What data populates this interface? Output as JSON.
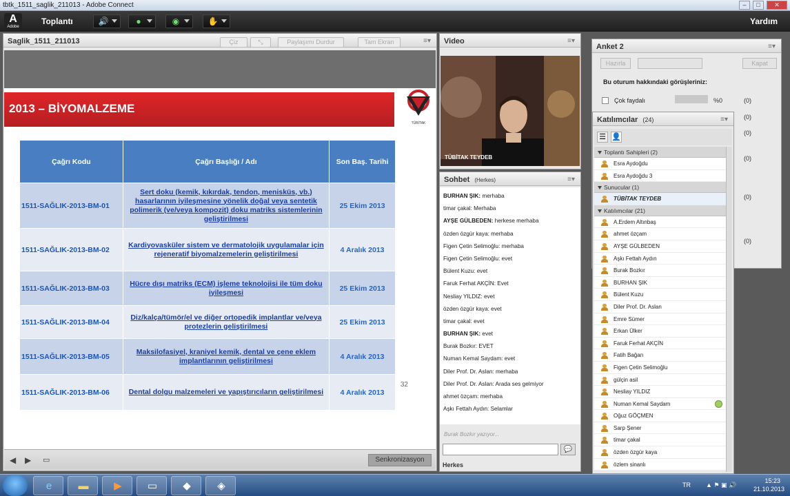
{
  "window": {
    "title": "tbtk_1511_saglik_211013 - Adobe Connect"
  },
  "menubar": {
    "logo_letter": "A",
    "logo_sub": "Adobe",
    "meeting_menu": "Toplantı",
    "help_menu": "Yardım"
  },
  "share_pod": {
    "title": "Saglik_1511_211013",
    "buttons": {
      "draw": "Çiz",
      "stop_sharing": "Paylaşımı Durdur",
      "fullscreen": "Tam Ekran"
    },
    "sync_button": "Senkronizasyon"
  },
  "slide": {
    "heading": "2013 – BİYOMALZEME",
    "logo_text": "TÜBİTAK",
    "page_number": "32",
    "table": {
      "headers": {
        "code": "Çağrı Kodu",
        "title": "Çağrı  Başlığı / Adı",
        "deadline": "Son Baş. Tarihi"
      },
      "rows": [
        {
          "code": "1511-SAĞLIK-2013-BM-01",
          "title": "Sert doku (kemik, kıkırdak, tendon, menisküs, vb.) hasarlarının iyileşmesine yönelik doğal veya sentetik polimerik (ve/veya kompozit) doku matriks sistemlerinin geliştirilmesi",
          "deadline": "25 Ekim 2013"
        },
        {
          "code": "1511-SAĞLIK-2013-BM-02",
          "title": "Kardiyovasküler sistem ve dermatolojik uygulamalar için rejeneratif biyomalzemelerin geliştirilmesi",
          "deadline": "4 Aralık 2013"
        },
        {
          "code": "1511-SAĞLIK-2013-BM-03",
          "title": "Hücre dışı matriks (ECM) işleme teknolojisi ile tüm doku iyileşmesi",
          "deadline": "25 Ekim 2013"
        },
        {
          "code": "1511-SAĞLIK-2013-BM-04",
          "title": "Diz/kalça/tümör/el ve diğer ortopedik implantlar ve/veya protezlerin geliştirilmesi",
          "deadline": "25 Ekim 2013"
        },
        {
          "code": "1511-SAĞLIK-2013-BM-05",
          "title": "Maksilofasiyel, kraniyel kemik, dental ve çene eklem implantlarının geliştirilmesi",
          "deadline": "4 Aralık 2013"
        },
        {
          "code": "1511-SAĞLIK-2013-BM-06",
          "title": "Dental dolgu malzemeleri ve yapıştırıcıların geliştirilmesi",
          "deadline": "4 Aralık 2013"
        }
      ]
    }
  },
  "video_pod": {
    "title": "Video",
    "camera_label": "TÜBİTAK TEYDEB"
  },
  "chat_pod": {
    "title": "Sohbet",
    "scope": "(Herkes)",
    "messages": [
      {
        "sender": "BURHAN ŞIK:",
        "text": " merhaba"
      },
      {
        "sender": "",
        "text": "timar çakal: Merhaba"
      },
      {
        "sender": "AYŞE GÜLBEDEN:",
        "text": " herkese merhaba"
      },
      {
        "sender": "",
        "text": "özden özgür kaya: merhaba"
      },
      {
        "sender": "",
        "text": "Figen Çetin Selimoğlu: merhaba"
      },
      {
        "sender": "",
        "text": "Figen Çetin Selimoğlu: evet"
      },
      {
        "sender": "",
        "text": "Bülent Kuzu: evet"
      },
      {
        "sender": "",
        "text": "Faruk Ferhat AKÇİN: Evet"
      },
      {
        "sender": "",
        "text": "Nesliay YILDIZ: evet"
      },
      {
        "sender": "",
        "text": "özden özgür kaya: evet"
      },
      {
        "sender": "",
        "text": "timar çakal: evet"
      },
      {
        "sender": "BURHAN ŞIK:",
        "text": " evet"
      },
      {
        "sender": "",
        "text": "Burak Bozkır: EVET"
      },
      {
        "sender": "",
        "text": "Numan Kemal Saydam: evet"
      },
      {
        "sender": "",
        "text": "Diler Prof. Dr. Aslan: merhaba"
      },
      {
        "sender": "",
        "text": "Diler Prof. Dr. Aslan: Arada ses gelmiyor"
      },
      {
        "sender": "",
        "text": "ahmet özçam: merhaba"
      },
      {
        "sender": "",
        "text": "Aşkı Fettah Aydın: Selamlar"
      }
    ],
    "typing_indicator": "Burak Bozkır yazıyor...",
    "send_to": "Herkes"
  },
  "poll_pod": {
    "title": "Anket 2",
    "buttons": {
      "prepare": "Hazırla",
      "close": "Kapat"
    },
    "question": "Bu oturum hakkındaki görüşleriniz:",
    "options": [
      {
        "label": "Çok faydalı",
        "percent": "%0",
        "count": "(0)"
      }
    ],
    "extra_counts": [
      "(0)",
      "(0)",
      "(0)",
      "(0)",
      "(0)"
    ]
  },
  "attendee_pod": {
    "title": "Katılımcılar",
    "count": "(24)",
    "groups": [
      {
        "label": "Toplantı Sahipleri (2)",
        "members": [
          "Esra Aydoğdu",
          "Esra Aydoğdu 3"
        ]
      },
      {
        "label": "Sunucular (1)",
        "members": [
          "TÜBİTAK TEYDEB"
        ]
      },
      {
        "label": "Katılımcılar (21)",
        "members": [
          "A.Erdem Altınbaş",
          "ahmet özçam",
          "AYŞE GÜLBEDEN",
          "Aşkı Fettah Aydın",
          "Burak Bozkır",
          "BURHAN ŞIK",
          "Bülent Kuzu",
          "Diler Prof. Dr. Aslan",
          "Emre Sümer",
          "Erkan Ülker",
          "Faruk Ferhat AKÇİN",
          "Fatih Bağan",
          "Figen Çetin Selimoğlu",
          "gülçin asil",
          "Nesliay YILDIZ",
          "Numan Kemal Saydam",
          "Oğuz GÖÇMEN",
          "Sarp Şener",
          "timar çakal",
          "özden özgür kaya",
          "özlem sinanlı"
        ]
      }
    ]
  },
  "taskbar": {
    "language": "TR",
    "time": "15:23",
    "date": "21.10.2013"
  },
  "colors": {
    "slide_red": "#c8202a",
    "table_header": "#4a7ec2",
    "link_blue": "#1a3ea6"
  }
}
